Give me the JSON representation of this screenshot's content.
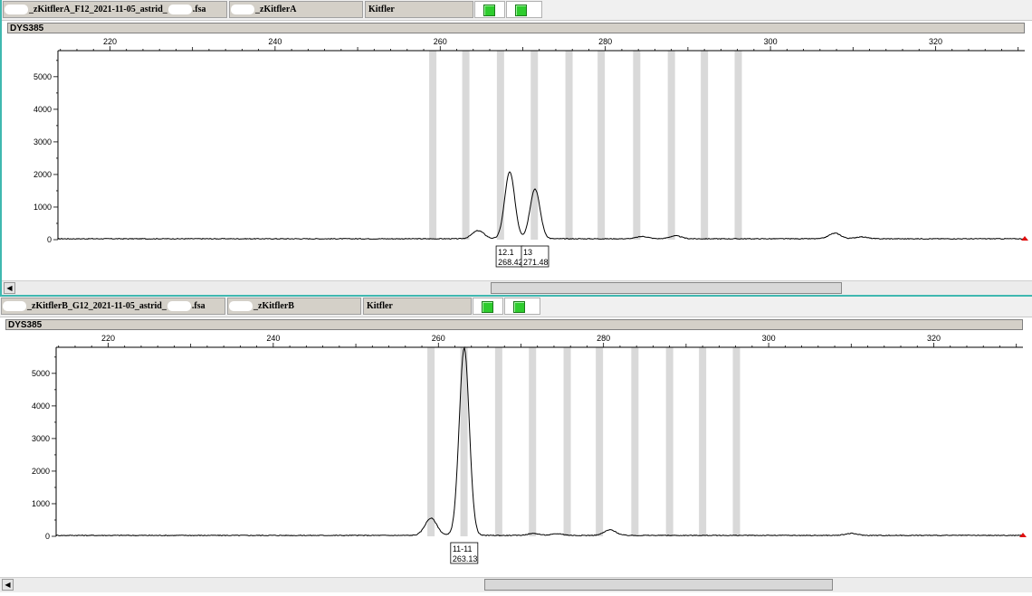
{
  "panels": [
    {
      "file": "_zKitflerA_F12_2021-11-05_astrid_",
      "file_ext": ".fsa",
      "sample": "_zKitflerA",
      "kit": "Kitfler",
      "locus": "DYS385",
      "scroll": {
        "thumb_start_fraction": 0.474,
        "thumb_end_fraction": 0.814
      }
    },
    {
      "file": "_zKitflerB_G12_2021-11-05_astrid_",
      "file_ext": ".fsa",
      "sample": "_zKitflerB",
      "kit": "Kitfler",
      "locus": "DYS385",
      "scroll": {
        "thumb_start_fraction": 0.469,
        "thumb_end_fraction": 0.807
      }
    }
  ],
  "chart_data": [
    {
      "type": "line",
      "title": "DYS385",
      "xlabel": "",
      "ylabel": "",
      "xlim": [
        213.7,
        330.8
      ],
      "ylim": [
        0,
        5800
      ],
      "x_ticks": [
        220,
        240,
        260,
        280,
        300,
        320
      ],
      "y_ticks": [
        0,
        1000,
        2000,
        3000,
        4000,
        5000
      ],
      "bins": [
        259.1,
        263.1,
        267.3,
        271.4,
        275.6,
        279.5,
        283.8,
        288.0,
        292.0,
        296.1
      ],
      "peaks": [
        {
          "x": 264.6,
          "height": 250
        },
        {
          "x": 268.42,
          "height": 2050
        },
        {
          "x": 271.48,
          "height": 1530
        },
        {
          "x": 284.5,
          "height": 70
        },
        {
          "x": 288.5,
          "height": 90
        },
        {
          "x": 307.8,
          "height": 170
        },
        {
          "x": 311.0,
          "height": 60
        }
      ],
      "alleles": [
        {
          "x": 268.42,
          "call": "12.1",
          "size": "268.42"
        },
        {
          "x": 271.48,
          "call": "13",
          "size": "271.48"
        }
      ]
    },
    {
      "type": "line",
      "title": "DYS385",
      "xlabel": "",
      "ylabel": "",
      "xlim": [
        213.7,
        330.8
      ],
      "ylim": [
        0,
        5800
      ],
      "x_ticks": [
        220,
        240,
        260,
        280,
        300,
        320
      ],
      "y_ticks": [
        0,
        1000,
        2000,
        3000,
        4000,
        5000
      ],
      "bins": [
        259.1,
        263.1,
        267.3,
        271.4,
        275.6,
        279.5,
        283.8,
        288.0,
        292.0,
        296.1
      ],
      "peaks": [
        {
          "x": 259.1,
          "height": 530
        },
        {
          "x": 263.13,
          "height": 5750
        },
        {
          "x": 271.5,
          "height": 60
        },
        {
          "x": 280.8,
          "height": 170
        },
        {
          "x": 274.5,
          "height": 50
        },
        {
          "x": 310.0,
          "height": 60
        }
      ],
      "alleles": [
        {
          "x": 263.13,
          "call": "11-11",
          "size": "263.13"
        }
      ]
    }
  ]
}
